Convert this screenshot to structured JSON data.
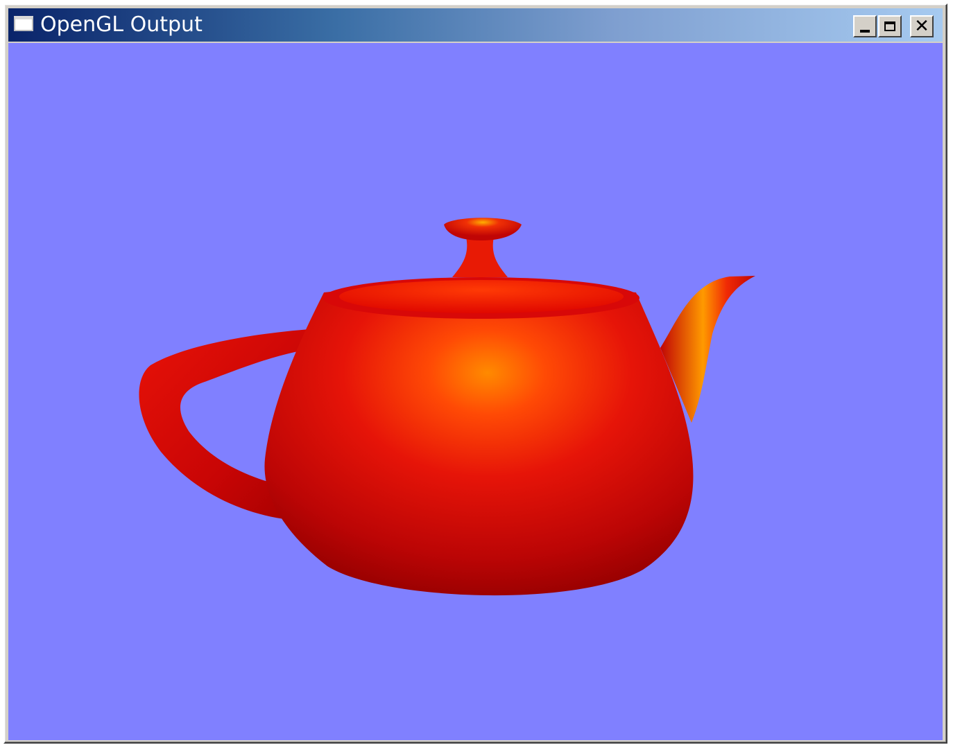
{
  "window": {
    "title": "OpenGL Output",
    "icon": "window-icon",
    "controls": {
      "minimize_icon": "minimize-icon",
      "maximize_icon": "maximize-icon",
      "close_icon": "close-icon",
      "close_glyph": "✕"
    }
  },
  "viewport": {
    "background_color": "#8080ff",
    "object": "teapot",
    "object_color": "#e00a00",
    "highlight_color": "#ff8a00"
  }
}
